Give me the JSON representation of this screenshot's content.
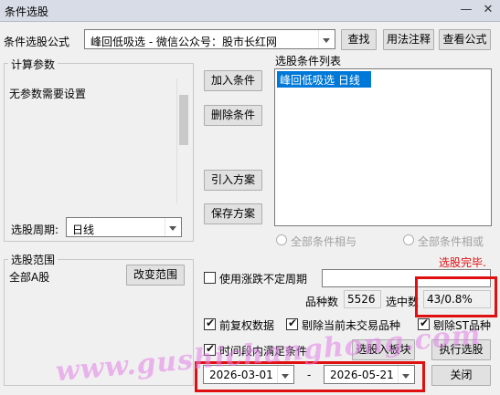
{
  "window": {
    "title": "条件选股",
    "minimize": "—",
    "close": "✕"
  },
  "formula": {
    "label": "条件选股公式",
    "selected": "峰回低吸选  -  微信公众号：股市长红网",
    "buttons": {
      "find": "查找",
      "usage": "用法注释",
      "view": "查看公式"
    }
  },
  "params": {
    "title": "计算参数",
    "text": "无参数需要设置",
    "period_label": "选股周期:",
    "period_value": "日线"
  },
  "actions": {
    "add": "加入条件",
    "delete": "删除条件",
    "import": "引入方案",
    "save": "保存方案"
  },
  "conditions": {
    "title": "选股条件列表",
    "items": [
      {
        "label": "峰回低吸选  日线"
      }
    ],
    "radio_and": "全部条件相与",
    "radio_or": "全部条件相或"
  },
  "status": "选股完毕.",
  "range": {
    "title": "选股范围",
    "value": "全部A股",
    "change_button": "改变范围"
  },
  "options": {
    "use_uncertain_period": "使用涨跌不定周期",
    "count_label": "品种数",
    "count_value": "5526",
    "selected_label": "选中数",
    "selected_value": "43/0.8%",
    "prior_adjust": "前复权数据",
    "exclude_untraded": "剔除当前未交易品种",
    "exclude_st": "剔除ST品种",
    "time_range": "时间段内满足条件"
  },
  "dates": {
    "start": "2026-03-01",
    "dash": "-",
    "end": "2026-05-21"
  },
  "bottom_buttons": {
    "to_block": "选股入板块",
    "run": "执行选股",
    "close": "关闭"
  },
  "watermark": "www.gushichanghong.com",
  "colors": {
    "highlight": "#0078d7",
    "status_red": "#e01010",
    "callout": "#e01010"
  }
}
